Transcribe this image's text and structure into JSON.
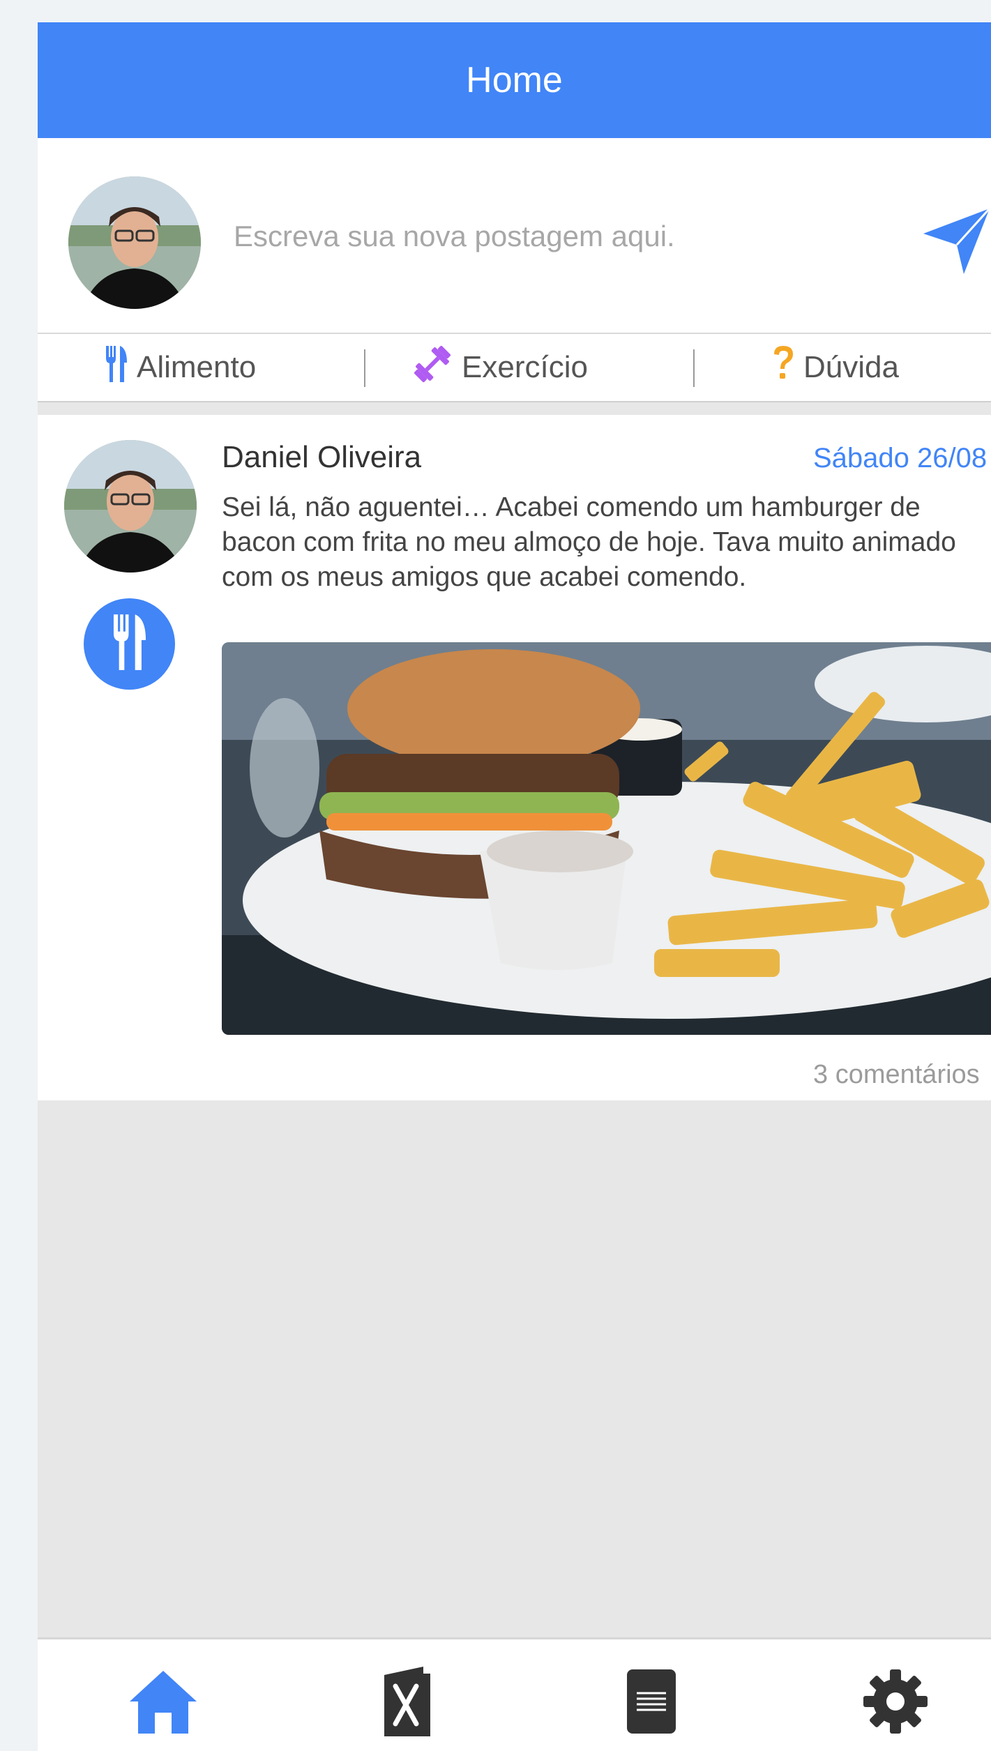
{
  "header": {
    "title": "Home"
  },
  "composer": {
    "placeholder": "Escreva sua nova postagem aqui."
  },
  "categories": [
    {
      "label": "Alimento",
      "icon": "fork-knife-icon",
      "color": "#4185f7"
    },
    {
      "label": "Exercício",
      "icon": "dumbbell-icon",
      "color": "#b05cf2"
    },
    {
      "label": "Dúvida",
      "icon": "question-icon",
      "color": "#f5a623"
    }
  ],
  "post": {
    "author": "Daniel Oliveira",
    "date": "Sábado 26/08",
    "text": "Sei lá, não aguentei… Acabei comendo um hamburger de bacon com frita no meu almoço de hoje. Tava muito animado com os meus amigos que acabei comendo.",
    "comments": "3 comentários",
    "type_icon": "fork-knife-icon"
  },
  "tabbar": [
    {
      "icon": "home-icon",
      "active": true
    },
    {
      "icon": "menu-book-icon",
      "active": false
    },
    {
      "icon": "document-icon",
      "active": false
    },
    {
      "icon": "gear-icon",
      "active": false
    }
  ],
  "colors": {
    "accent": "#4185f7",
    "background": "#e7e7e7"
  }
}
